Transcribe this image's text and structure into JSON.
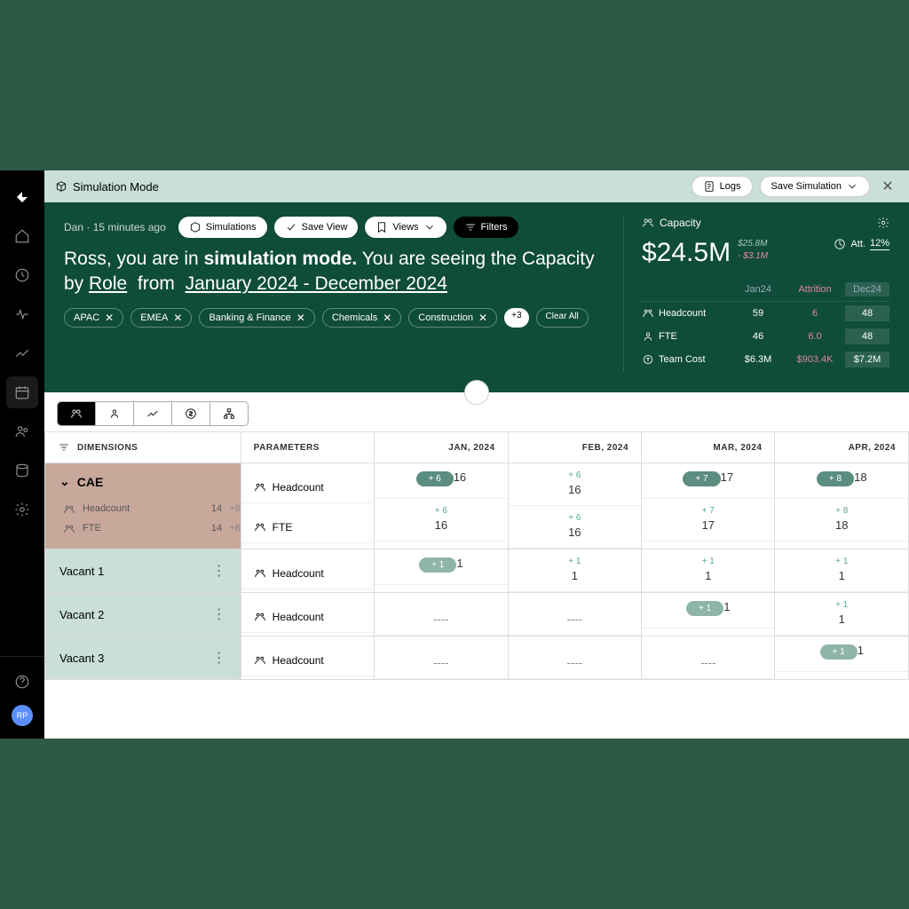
{
  "topbar": {
    "title": "Simulation Mode",
    "logs": "Logs",
    "save": "Save Simulation"
  },
  "header": {
    "author": "Dan",
    "time": "15 minutes ago",
    "btn_sim": "Simulations",
    "btn_save": "Save View",
    "btn_views": "Views",
    "btn_filters": "Filters",
    "headline_1": "Ross, you are in ",
    "headline_bold": "simulation mode.",
    "headline_2": " You are seeing the Capacity by ",
    "role": "Role",
    "from": " from ",
    "range": "January 2024 - December 2024",
    "chips": [
      "APAC",
      "EMEA",
      "Banking & Finance",
      "Chemicals",
      "Construction"
    ],
    "chip_more": "+3",
    "clear": "Clear All"
  },
  "capacity": {
    "label": "Capacity",
    "amount": "$24.5M",
    "sub1": "$25.8M",
    "sub2": "- $3.1M",
    "att_label": "Att.",
    "att_val": "12%",
    "cols": {
      "c1": "Jan24",
      "c2": "Attrition",
      "c3": "Dec24"
    },
    "rows": [
      {
        "label": "Headcount",
        "a": "59",
        "b": "6",
        "c": "48"
      },
      {
        "label": "FTE",
        "a": "46",
        "b": "6.0",
        "c": "48"
      },
      {
        "label": "Team Cost",
        "a": "$6.3M",
        "b": "$903.4K",
        "c": "$7.2M"
      }
    ]
  },
  "columns": {
    "dim": "DIMENSIONS",
    "param": "PARAMETERS",
    "m1": "JAN, 2024",
    "m2": "FEB, 2024",
    "m3": "MAR, 2024",
    "m4": "APR, 2024"
  },
  "cae": {
    "name": "CAE",
    "sub": [
      {
        "label": "Headcount",
        "v1": "14",
        "v2": "+8"
      },
      {
        "label": "FTE",
        "v1": "14",
        "v2": "+8"
      }
    ],
    "params": [
      "Headcount",
      "FTE"
    ],
    "months": [
      {
        "hc_d": "+ 6",
        "hc": "16",
        "fte_d": "+ 6",
        "fte": "16"
      },
      {
        "hc_d": "+ 6",
        "hc": "16",
        "fte_d": "+ 6",
        "fte": "16"
      },
      {
        "hc_d": "+ 7",
        "hc": "17",
        "fte_d": "+ 7",
        "fte": "17"
      },
      {
        "hc_d": "+ 8",
        "hc": "18",
        "fte_d": "+ 8",
        "fte": "18"
      }
    ]
  },
  "vacant": [
    {
      "name": "Vacant 1",
      "param": "Headcount",
      "m": [
        {
          "d": "+ 1",
          "v": "1",
          "pill": true
        },
        {
          "d": "+ 1",
          "v": "1"
        },
        {
          "d": "+ 1",
          "v": "1"
        },
        {
          "d": "+ 1",
          "v": "1"
        }
      ]
    },
    {
      "name": "Vacant 2",
      "param": "Headcount",
      "m": [
        {
          "d": "",
          "v": "----"
        },
        {
          "d": "",
          "v": "----"
        },
        {
          "d": "+ 1",
          "v": "1",
          "pill": true
        },
        {
          "d": "+ 1",
          "v": "1"
        }
      ]
    },
    {
      "name": "Vacant 3",
      "param": "Headcount",
      "m": [
        {
          "d": "",
          "v": "----"
        },
        {
          "d": "",
          "v": "----"
        },
        {
          "d": "",
          "v": "----"
        },
        {
          "d": "+ 1",
          "v": "1",
          "pill": true
        }
      ]
    }
  ],
  "avatar": "RP"
}
